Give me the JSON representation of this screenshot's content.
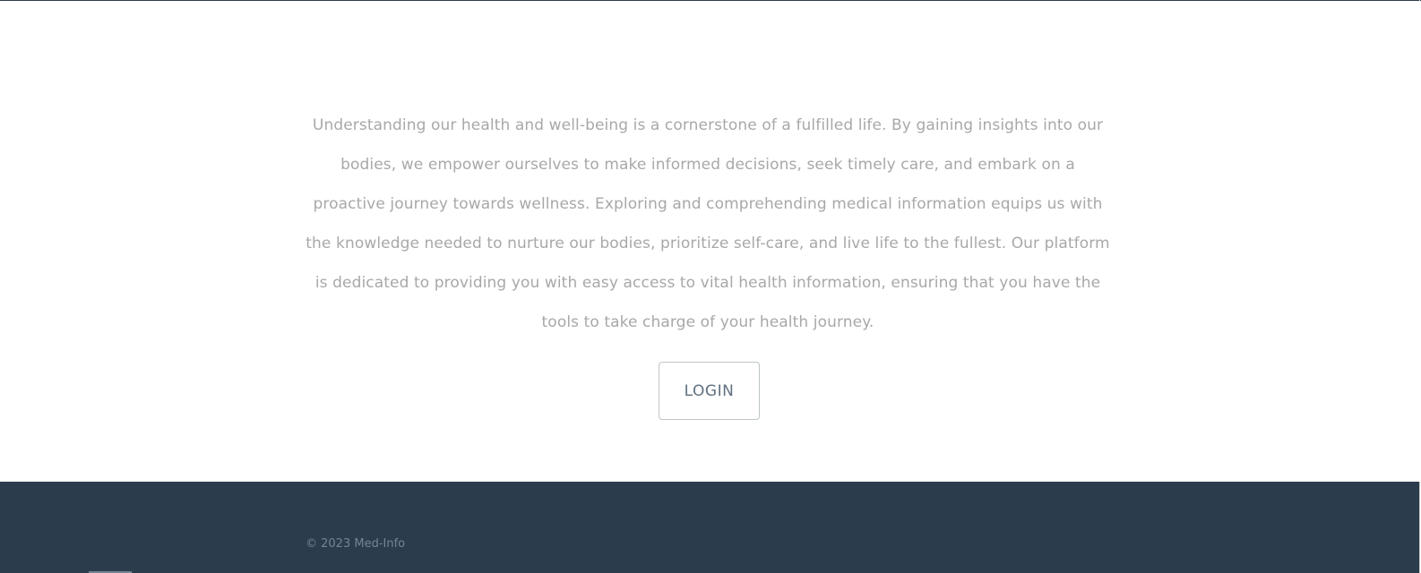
{
  "content": {
    "intro_text": "Understanding our health and well-being is a cornerstone of a fulfilled life. By gaining insights into our bodies, we empower ourselves to make informed decisions, seek timely care, and embark on a proactive journey towards wellness. Exploring and comprehending medical information equips us with the knowledge needed to nurture our bodies, prioritize self-care, and live life to the fullest. Our platform is dedicated to providing you with easy access to vital health information, ensuring that you have the tools to take charge of your health journey.",
    "login_label": "LOGIN"
  },
  "footer": {
    "copyright": "© 2023 Med-Info"
  },
  "colors": {
    "footer_background": "#2b3d4d",
    "body_text": "#a8a8a8",
    "button_text": "#5f7080",
    "copyright_text": "#6f8596"
  }
}
